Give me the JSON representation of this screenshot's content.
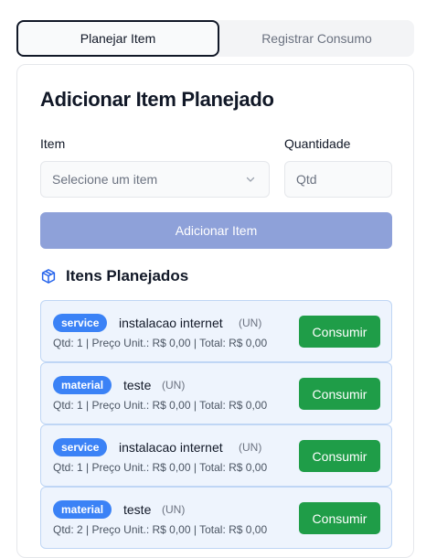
{
  "tabs": {
    "plan": "Planejar Item",
    "consume": "Registrar Consumo"
  },
  "form": {
    "title": "Adicionar Item Planejado",
    "item_label": "Item",
    "item_placeholder": "Selecione um item",
    "qty_label": "Quantidade",
    "qty_placeholder": "Qtd",
    "add_button": "Adicionar Item"
  },
  "planned": {
    "title": "Itens Planejados",
    "consume_label": "Consumir",
    "items": [
      {
        "type": "service",
        "name": "instalacao internet",
        "unit": "(UN)",
        "meta": "Qtd: 1 | Preço Unit.: R$ 0,00 | Total: R$ 0,00"
      },
      {
        "type": "material",
        "name": "teste",
        "unit": "(UN)",
        "meta": "Qtd: 1 | Preço Unit.: R$ 0,00 | Total: R$ 0,00"
      },
      {
        "type": "service",
        "name": "instalacao internet",
        "unit": "(UN)",
        "meta": "Qtd: 1 | Preço Unit.: R$ 0,00 | Total: R$ 0,00"
      },
      {
        "type": "material",
        "name": "teste",
        "unit": "(UN)",
        "meta": "Qtd: 2 | Preço Unit.: R$ 0,00 | Total: R$ 0,00"
      }
    ]
  },
  "colors": {
    "badge": "#3b82f6",
    "consume_button": "#1f9d48",
    "add_button_disabled": "#8ea1d9",
    "row_bg": "#eef4fd",
    "row_border": "#bfd6f5"
  },
  "icons": {
    "section": "package-icon",
    "select": "chevron-down-icon"
  }
}
